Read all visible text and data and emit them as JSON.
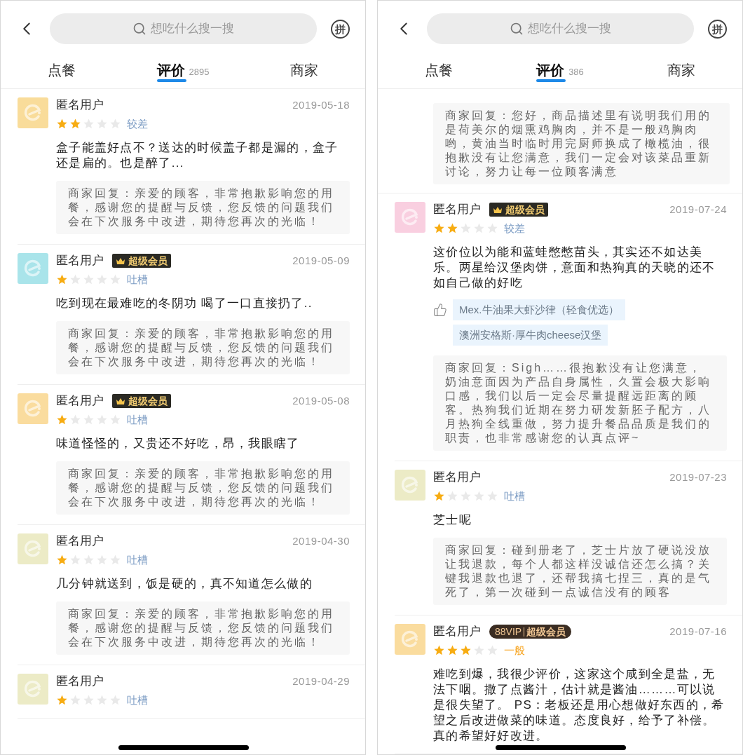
{
  "screens": [
    {
      "header": {
        "action": "拼"
      },
      "search": {
        "placeholder": "想吃什么搜一搜"
      },
      "tabs": [
        {
          "label": "点餐",
          "selected": false
        },
        {
          "label": "评价",
          "count": "2895",
          "selected": true
        },
        {
          "label": "商家",
          "selected": false
        }
      ],
      "reviews": [
        {
          "kind": "review",
          "color": "#f9dc9a",
          "user": "匿名用户",
          "date": "2019-05-18",
          "stars": 2,
          "rating": "较差",
          "text": "盒子能盖好点不？送达的时候盖子都是漏的，盒子还是扁的。也是醉了...",
          "reply": "商家回复：亲爱的顾客，非常抱歉影响您的用餐，感谢您的提醒与反馈，您反馈的问题我们会在下次服务中改进，期待您再次的光临！"
        },
        {
          "kind": "review",
          "color": "#a9e4ea",
          "user": "匿名用户",
          "badge": {
            "kind": "super",
            "parts": [
              "超级会员"
            ]
          },
          "date": "2019-05-09",
          "stars": 1,
          "rating": "吐槽",
          "text": "吃到现在最难吃的冬阴功 喝了一口直接扔了..",
          "reply": "商家回复：亲爱的顾客，非常抱歉影响您的用餐，感谢您的提醒与反馈，您反馈的问题我们会在下次服务中改进，期待您再次的光临！"
        },
        {
          "kind": "review",
          "color": "#fadc9e",
          "user": "匿名用户",
          "badge": {
            "kind": "super",
            "parts": [
              "超级会员"
            ]
          },
          "date": "2019-05-08",
          "stars": 1,
          "rating": "吐槽",
          "text": "味道怪怪的，又贵还不好吃，昂，我眼瞎了",
          "reply": "商家回复：亲爱的顾客，非常抱歉影响您的用餐，感谢您的提醒与反馈，您反馈的问题我们会在下次服务中改进，期待您再次的光临！"
        },
        {
          "kind": "review",
          "color": "#ecebc6",
          "user": "匿名用户",
          "date": "2019-04-30",
          "stars": 1,
          "rating": "吐槽",
          "text": "几分钟就送到，饭是硬的，真不知道怎么做的",
          "reply": "商家回复：亲爱的顾客，非常抱歉影响您的用餐，感谢您的提醒与反馈，您反馈的问题我们会在下次服务中改进，期待您再次的光临！"
        },
        {
          "kind": "review",
          "color": "#ecebc6",
          "user": "匿名用户",
          "date": "2019-04-29",
          "stars": 1,
          "rating": "吐槽"
        }
      ]
    },
    {
      "header": {
        "action": "拼"
      },
      "search": {
        "placeholder": "想吃什么搜一搜"
      },
      "tabs": [
        {
          "label": "点餐",
          "selected": false
        },
        {
          "label": "评价",
          "count": "386",
          "selected": true
        },
        {
          "label": "商家",
          "selected": false
        }
      ],
      "reviews": [
        {
          "kind": "reply_only",
          "reply": "商家回复：您好，商品描述里有说明我们用的是荷美尔的烟熏鸡胸肉，并不是一般鸡胸肉哟，黄油当时临时用完厨师换成了橄榄油，很抱歉没有让您满意，我们一定会对该菜品重新讨论，努力让每一位顾客满意"
        },
        {
          "kind": "review",
          "color": "#f9cfe0",
          "user": "匿名用户",
          "badge": {
            "kind": "super",
            "parts": [
              "超级会员"
            ]
          },
          "date": "2019-07-24",
          "stars": 2,
          "rating": "较差",
          "text": "这价位以为能和蓝蛙憋憋苗头，其实还不如达美乐。两星给汉堡肉饼，意面和热狗真的天晓的还不如自己做的好吃",
          "liked": [
            "Mex.牛油果大虾沙律（轻食优选）",
            "澳洲安格斯·厚牛肉cheese汉堡"
          ],
          "reply": "商家回复：Sigh……很抱歉没有让您满意，奶油意面因为产品自身属性，久置会极大影响口感，我们以后一定会尽量提醒远距离的顾客。热狗我们近期在努力研发新胚子配方，八月热狗全线重做，努力提升餐品品质是我们的职责，也非常感谢您的认真点评~"
        },
        {
          "kind": "review",
          "color": "#ecebc6",
          "user": "匿名用户",
          "date": "2019-07-23",
          "stars": 1,
          "rating": "吐槽",
          "text": "芝士呢",
          "reply": "商家回复：碰到册老了，芝士片放了硬说没放让我退款，每个人都这样没诚信还怎么搞？关键我退款也退了，还帮我搞七捏三，真的是气死了，第一次碰到一点诚信没有的顾客"
        },
        {
          "kind": "review",
          "color": "#fadc9e",
          "user": "匿名用户",
          "badge": {
            "kind": "vip",
            "parts": [
              "88VIP",
              "超级会员"
            ]
          },
          "date": "2019-07-16",
          "stars": 3,
          "rating": "一般",
          "text": "难吃到爆，我很少评价，这家这个咸到全是盐，无法下咽。撒了点酱汁，估计就是酱油………可以说是很失望了。 PS：老板还是用心想做好东西的，希望之后改进做菜的味道。态度良好，给予了补偿。真的希望好好改进。"
        }
      ]
    }
  ]
}
